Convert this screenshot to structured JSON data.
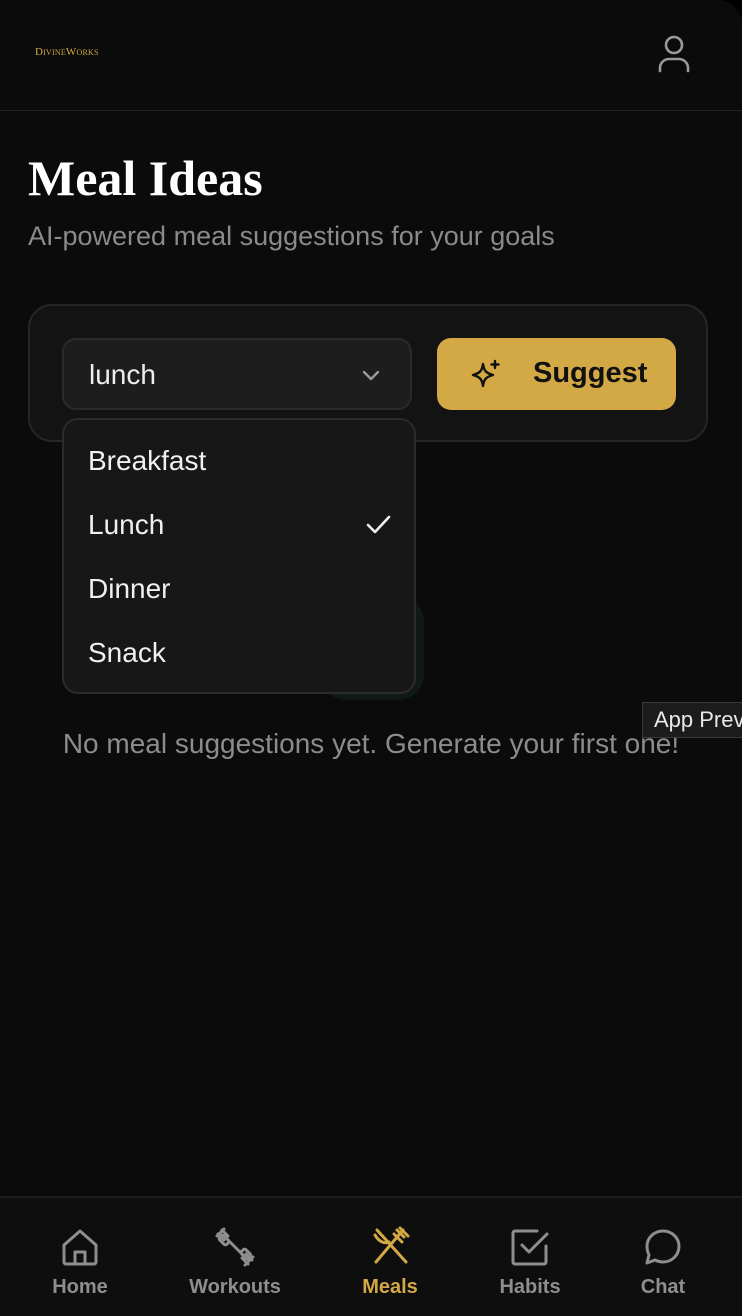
{
  "app": {
    "brand": "DivineWorks"
  },
  "page": {
    "title": "Meal Ideas",
    "subtitle": "AI-powered meal suggestions for your goals"
  },
  "meal_select": {
    "value": "lunch",
    "options": [
      {
        "label": "Breakfast",
        "selected": false
      },
      {
        "label": "Lunch",
        "selected": true
      },
      {
        "label": "Dinner",
        "selected": false
      },
      {
        "label": "Snack",
        "selected": false
      }
    ]
  },
  "suggest_button": {
    "label": "Suggest",
    "icon": "sparkles-icon"
  },
  "empty_state": {
    "text": "No meal suggestions yet. Generate your first one!"
  },
  "preview_tag": {
    "label": "App Preview"
  },
  "nav": {
    "items": [
      {
        "label": "Home",
        "icon": "home-icon",
        "active": false
      },
      {
        "label": "Workouts",
        "icon": "dumbbell-icon",
        "active": false
      },
      {
        "label": "Meals",
        "icon": "utensils-icon",
        "active": true
      },
      {
        "label": "Habits",
        "icon": "checkbox-icon",
        "active": false
      },
      {
        "label": "Chat",
        "icon": "chat-bubble-icon",
        "active": false
      }
    ]
  },
  "colors": {
    "accent": "#d3a945",
    "background": "#0b0b0b",
    "muted_text": "#8a8a8a"
  }
}
